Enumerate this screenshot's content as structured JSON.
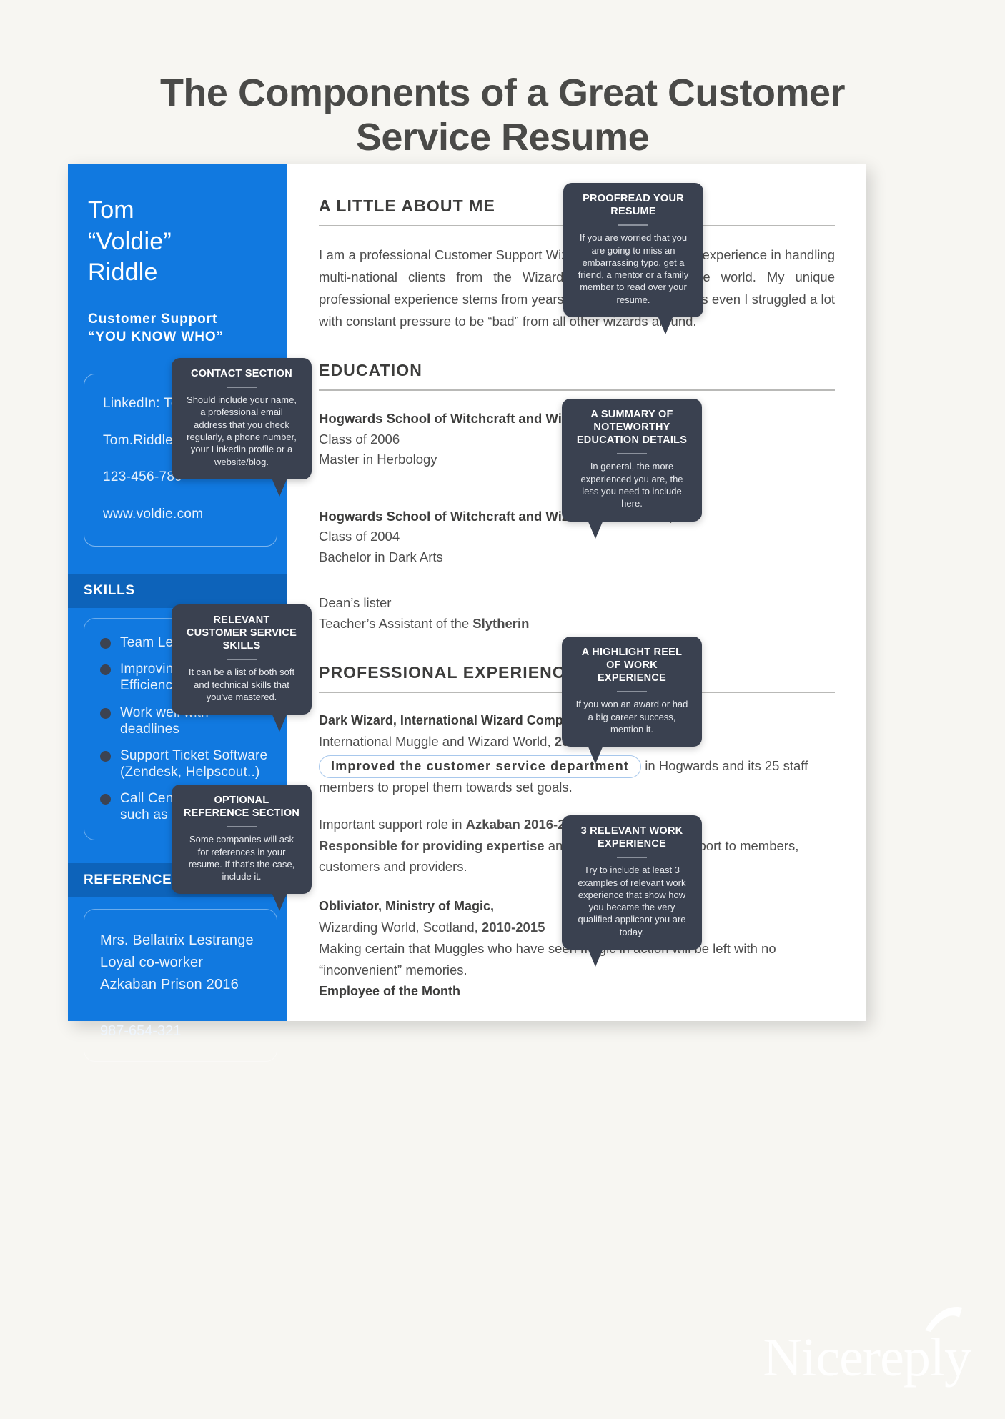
{
  "title": "The Components of a Great Customer Service Resume",
  "brand": {
    "name": "Nicereply",
    "accent": "#1179e0",
    "callout_bg": "#3a4150"
  },
  "sidebar": {
    "name": "Tom\n“Voldie”\nRiddle",
    "role_line1": "Customer Support",
    "role_line2": "“YOU KNOW WHO”",
    "contact": [
      "LinkedIn: Tom Riddle",
      "Tom.Riddle@gmail.com",
      "123-456-789",
      "www.voldie.com"
    ],
    "skills_heading": "SKILLS",
    "skills": [
      "Team Leadership",
      "Improving Support Efficiency",
      "Work well with deadlines",
      "Support Ticket Software (Zendesk, Helpscout..)",
      "Call Center systems such as OMNI, CMS"
    ],
    "references_heading": "REFERENCES",
    "reference_name": "Mrs. Bellatrix Lestrange",
    "reference_role": "Loyal co-worker",
    "reference_place": "Azkaban Prison 2016",
    "reference_phone": "987-654-321"
  },
  "main": {
    "about_heading": "A LITTLE ABOUT ME",
    "about_body": "I am a professional Customer Support Wizard with over 25 years experience in handling multi-national clients from the Wizarding world and Muggle world. My unique professional experience stems from years of mastering my powers even I struggled a lot with constant pressure to be “bad” from all other wizards around.",
    "education_heading": "EDUCATION",
    "education": [
      {
        "school": "Hogwards School of Witchcraft and Wizardry - Scotland,",
        "class": "Class of 2006",
        "degree": "Master in Herbology"
      },
      {
        "school": "Hogwards School of Witchcraft and Wizardry - Scotland,",
        "class": "Class of 2004",
        "degree": "Bachelor in Dark Arts"
      }
    ],
    "education_extra_1": "Dean’s lister",
    "education_extra_2_pre": "Teacher’s Assistant of the ",
    "education_extra_2_bold": "Slytherin",
    "experience_heading": "PROFESSIONAL EXPERIENCE",
    "jobs": [
      {
        "title": "Dark Wizard, International Wizard Company, Inc.",
        "sub_pre": "International Muggle and Wizard World, ",
        "sub_bold": "2018-present",
        "highlight": "Improved the customer service department",
        "body_after": " in Hogwards and its 25 staff members to propel them towards set goals."
      },
      {
        "line1_pre": "Important support role in ",
        "line1_bold": "Azkaban 2016-2018.",
        "body_bold": "Responsible for providing expertise",
        "body_rest": " and customer service support to members, customers and providers."
      },
      {
        "title": "Obliviator, Ministry of Magic,",
        "sub_pre": "Wizarding World, Scotland, ",
        "sub_bold": "2010-2015",
        "body": "Making certain that Muggles who have seen magic in action will be left with no “inconvenient” memories.",
        "award": "Employee of the Month"
      }
    ]
  },
  "callouts": [
    {
      "id": "proofread",
      "title": "PROOFREAD YOUR RESUME",
      "body": "If you are worried that you are going to miss an embarrassing typo, get a friend, a mentor or a family member to read over your resume."
    },
    {
      "id": "contact-section",
      "title": "CONTACT SECTION",
      "body": "Should include your name, a professional email address that you check regularly, a phone number, your Linkedin profile or a website/blog."
    },
    {
      "id": "education-summary",
      "title": "A SUMMARY OF NOTEWORTHY EDUCATION DETAILS",
      "body": "In general, the more experienced you are, the less you need to include here."
    },
    {
      "id": "skills",
      "title": "RELEVANT CUSTOMER SERVICE SKILLS",
      "body": "It can be a list of both soft and technical skills that you've mastered."
    },
    {
      "id": "highlight-reel",
      "title": "A HIGHLIGHT REEL OF WORK EXPERIENCE",
      "body": "If you won an award or had a big career success, mention it."
    },
    {
      "id": "optional-reference",
      "title": "OPTIONAL REFERENCE SECTION",
      "body": "Some companies will ask for references in your resume. If that's the case, include it."
    },
    {
      "id": "three-relevant",
      "title": "3 RELEVANT WORK EXPERIENCE",
      "body": "Try to include at least 3 examples of relevant work experience that show how you became the very qualified applicant you are today."
    }
  ]
}
